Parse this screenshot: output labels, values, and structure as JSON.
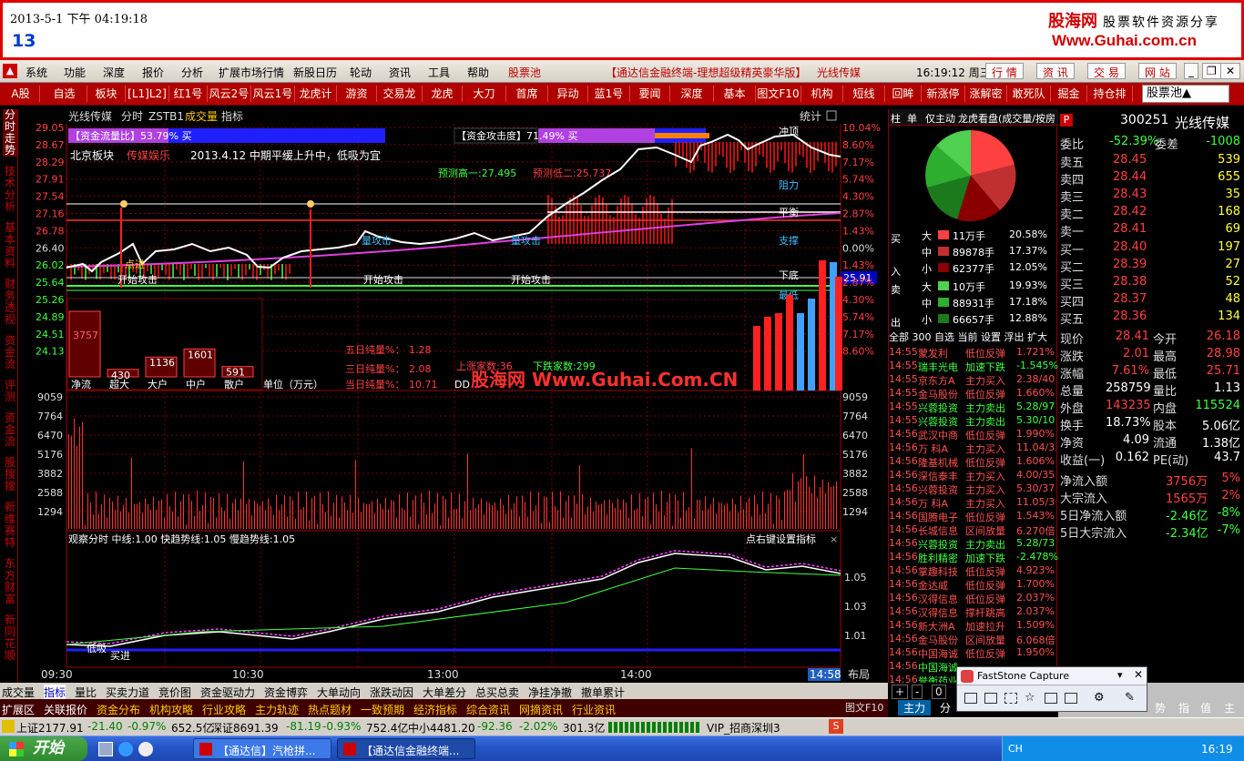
{
  "header": {
    "datetime": "2013-5-1 下午 04:19:18",
    "number": "13",
    "brand": "股海网",
    "brand_tag": "股票软件资源分享",
    "url": "Www.Guhai.com.cn"
  },
  "menu": {
    "items": [
      "系统",
      "功能",
      "深度",
      "报价",
      "分析",
      "扩展市场行情",
      "新股日历",
      "轮动",
      "资讯",
      "工具",
      "帮助"
    ],
    "stock_pool": "股票池",
    "title": "【通达信金融终端-理想超级精英豪华版】",
    "stock_title": "光线传媒",
    "time": "16:19:12 周三",
    "right_buttons": [
      "行 情",
      "资 讯",
      "交 易",
      "网 站"
    ]
  },
  "tabs": {
    "items": [
      "A股",
      "自选",
      "板块",
      "[L1]L2]",
      "红1号",
      "风云2号",
      "风云1号",
      "龙虎计",
      "游资",
      "交易龙",
      "龙虎",
      "大刀",
      "首席",
      "异动",
      "蓝1号",
      "要闻",
      "深度",
      "基本",
      "图文F10",
      "机构",
      "短线",
      "回眸",
      "新涨停",
      "涨解密",
      "敢死队",
      "掘金",
      "持仓排"
    ],
    "pool_select": "股票池▲"
  },
  "leftnav": [
    "分时走势",
    "技术分析",
    "基本资料",
    "财务透视",
    "资金流",
    "评测",
    "资金流",
    "股搜搜",
    "新维赛特",
    "东方财富",
    "新同花顺"
  ],
  "chart": {
    "title_items": [
      "光线传媒",
      "分时",
      "ZSTB1",
      "成交量",
      "指标"
    ],
    "stat_label": "统计",
    "zjl_label": "【资金流量比】53.79% 买",
    "zjgjd_label": "【资金攻击度】71.49% 买",
    "sector": "北京板块",
    "sector_tag": "传媒娱乐",
    "note": "2013.4.12 中期平缓上升中，低吸为宜",
    "pred_high": "预测高一:27.495",
    "pred_low": "预测低二:25.737",
    "zuli": "阻力",
    "pingheng": "平衡",
    "zhicheng": "支撑",
    "xiadi": "下底",
    "zuidi": "最低",
    "chongqi": "冲顶",
    "attack": "开始攻击",
    "attack2": "开始攻击",
    "qiang": "量攻击",
    "qiang2": "量攻击",
    "dian": "点进",
    "jin": "进",
    "chu": "出",
    "price_ticks": [
      "29.05",
      "28.67",
      "28.29",
      "27.91",
      "27.54",
      "27.16",
      "26.78",
      "26.40",
      "26.02",
      "25.64",
      "25.26",
      "24.89",
      "24.51",
      "24.13"
    ],
    "pct_ticks": [
      "10.04%",
      "8.60%",
      "7.17%",
      "5.74%",
      "4.30%",
      "2.87%",
      "1.43%",
      "0.00%",
      "1.43%",
      "2.87%",
      "4.30%",
      "5.74%",
      "7.17%",
      "8.60%"
    ],
    "current_price_tag": "25.91",
    "vol_ticks": [
      "9059",
      "7764",
      "6470",
      "5176",
      "3882",
      "2588",
      "1294"
    ],
    "money_flow": {
      "labels": [
        "净流",
        "超大",
        "大户",
        "中户",
        "散户"
      ],
      "values": [
        3757,
        430,
        1136,
        1601,
        591
      ],
      "unit": "单位（万元）"
    },
    "five_day": [
      {
        "label": "五日纯量%：",
        "value": "1.28"
      },
      {
        "label": "三日纯量%：",
        "value": "2.08"
      },
      {
        "label": "当日纯量%：",
        "value": "10.71"
      }
    ],
    "up_count": "上涨家数:36",
    "down_count": "下跌家数:299",
    "dd": "DD",
    "watermark": "股海网 Www.Guhai.Com.CN",
    "indicator": {
      "title": "观察分时 中线:1.00 快趋势线:1.05 慢趋势线:1.05",
      "setting": "点右键设置指标",
      "ticks": [
        "1.05",
        "1.03",
        "1.01"
      ],
      "ff": "低吸",
      "buy": "买进"
    },
    "time_axis": [
      "09:30",
      "10:30",
      "13:00",
      "14:00"
    ],
    "time_now": "14:58",
    "layout_label": "布局"
  },
  "chart_data": {
    "type": "line",
    "x": [
      "09:30",
      "10:30",
      "13:00",
      "14:00",
      "15:00"
    ],
    "series": [
      {
        "name": "光线传媒",
        "values": [
          26.4,
          26.1,
          26.6,
          28.0,
          28.41
        ]
      }
    ],
    "ylim": [
      24.13,
      29.05
    ]
  },
  "wpanel": {
    "tabs": [
      "柱",
      "单",
      "仅主动",
      "龙虎看盘(成交量/按房"
    ],
    "buy_rows": [
      {
        "k": "大",
        "v": "11万手",
        "p": "20.58%"
      },
      {
        "k": "中",
        "v": "89878手",
        "p": "17.37%"
      },
      {
        "k": "小",
        "v": "62377手",
        "p": "12.05%"
      }
    ],
    "sell_rows": [
      {
        "k": "大",
        "v": "10万手",
        "p": "19.93%"
      },
      {
        "k": "中",
        "v": "88931手",
        "p": "17.18%"
      },
      {
        "k": "小",
        "v": "66657手",
        "p": "12.88%"
      }
    ],
    "buy": "买",
    "in": "入",
    "sell": "卖",
    "out": "出",
    "filters": "全部 300  自选 当前 设置 浮出 扩大",
    "ticks": [
      [
        "14:55",
        "蒙发利",
        "低位反弹",
        "1.721%"
      ],
      [
        "14:55",
        "瑞丰光电",
        "加速下跌",
        "-1.545%"
      ],
      [
        "14:55",
        "京东方A",
        "主力买入",
        "2.38/40"
      ],
      [
        "14:55",
        "金马股份",
        "低位反弹",
        "1.660%"
      ],
      [
        "14:55",
        "兴蓉投资",
        "主力卖出",
        "5.28/97"
      ],
      [
        "14:55",
        "兴蓉投资",
        "主力卖出",
        "5.30/10"
      ],
      [
        "14:56",
        "武汉中商",
        "低位反弹",
        "1.990%"
      ],
      [
        "14:56",
        "万 科A",
        "主力买入",
        "11.04/3"
      ],
      [
        "14:56",
        "隆基机械",
        "低位反弹",
        "1.606%"
      ],
      [
        "14:56",
        "深信泰丰",
        "主力买入",
        "4.00/35"
      ],
      [
        "14:56",
        "兴蓉投资",
        "主力买入",
        "5.30/37"
      ],
      [
        "14:56",
        "万 科A",
        "主力买入",
        "11.05/3"
      ],
      [
        "14:56",
        "国腾电子",
        "低位反弹",
        "1.543%"
      ],
      [
        "14:56",
        "长城信息",
        "区间放量",
        "6.270倍"
      ],
      [
        "14:56",
        "兴蓉投资",
        "主力卖出",
        "5.28/73"
      ],
      [
        "14:56",
        "胜利精密",
        "加速下跌",
        "-2.478%"
      ],
      [
        "14:56",
        "掌趣科技",
        "低位反弹",
        "4.923%"
      ],
      [
        "14:56",
        "金达威",
        "低位反弹",
        "1.700%"
      ],
      [
        "14:56",
        "汉得信息",
        "低位反弹",
        "2.037%"
      ],
      [
        "14:56",
        "汉得信息",
        "撑杆跳高",
        "2.037%"
      ],
      [
        "14:56",
        "新大洲A",
        "加速拉升",
        "1.509%"
      ],
      [
        "14:56",
        "金马股份",
        "区间放量",
        "6.068倍"
      ],
      [
        "14:56",
        "中国海诚",
        "低位反弹",
        "1.950%"
      ],
      [
        "14:56",
        "中国海诚",
        "",
        ""
      ],
      [
        "14:56",
        "誉衡药业",
        "",
        ""
      ]
    ]
  },
  "quote": {
    "code": "300251",
    "name": "光线传媒",
    "weibi_l": "委比",
    "weibi": "-52.39%",
    "weicha_l": "委差",
    "weicha": "-1008",
    "asks": [
      {
        "l": "卖五",
        "p": "28.45",
        "v": "539"
      },
      {
        "l": "卖四",
        "p": "28.44",
        "v": "655"
      },
      {
        "l": "卖三",
        "p": "28.43",
        "v": "35"
      },
      {
        "l": "卖二",
        "p": "28.42",
        "v": "168"
      },
      {
        "l": "卖一",
        "p": "28.41",
        "v": "69"
      }
    ],
    "bids": [
      {
        "l": "买一",
        "p": "28.40",
        "v": "197"
      },
      {
        "l": "买二",
        "p": "28.39",
        "v": "27"
      },
      {
        "l": "买三",
        "p": "28.38",
        "v": "52"
      },
      {
        "l": "买四",
        "p": "28.37",
        "v": "48"
      },
      {
        "l": "买五",
        "p": "28.36",
        "v": "134"
      }
    ],
    "stats": [
      [
        "现价",
        "28.41",
        "今开",
        "26.18"
      ],
      [
        "涨跌",
        "2.01",
        "最高",
        "28.98"
      ],
      [
        "涨幅",
        "7.61%",
        "最低",
        "25.71"
      ],
      [
        "总量",
        "258759",
        "量比",
        "1.13"
      ],
      [
        "外盘",
        "143235",
        "内盘",
        "115524"
      ],
      [
        "换手",
        "18.73%",
        "股本",
        "5.06亿"
      ],
      [
        "净资",
        "4.09",
        "流通",
        "1.38亿"
      ],
      [
        "收益(一)",
        "0.162",
        "PE(动)",
        "43.7"
      ]
    ],
    "flows": [
      [
        "净流入额",
        "3756万",
        "5%"
      ],
      [
        "大宗流入",
        "1565万",
        "2%"
      ],
      [
        "5日净流入额",
        "-2.46亿",
        "-8%"
      ],
      [
        "5日大宗流入",
        "-2.34亿",
        "-7%"
      ]
    ]
  },
  "bottom_tabs1": [
    "成交量",
    "指标",
    "量比",
    "买卖力道",
    "竞价图",
    "资金驱动力",
    "资金博弈",
    "大单动向",
    "涨跌动因",
    "大单差分",
    "总买总卖",
    "净挂净撤",
    "撤单累计"
  ],
  "bottom_tabs2": [
    "扩展区",
    "关联报价",
    "资金分布",
    "机构攻略",
    "行业攻略",
    "主力轨迹",
    "热点题材",
    "一致预期",
    "经济指标",
    "综合资讯",
    "网摘资讯",
    "行业资讯"
  ],
  "bottom_right": [
    "图文F10",
    "主力",
    "分"
  ],
  "bottom_far": [
    "势",
    "指",
    "值",
    "主"
  ],
  "status": {
    "sh": "上证2177.91",
    "sh_chg": "-21.40",
    "sh_pct": "-0.97%",
    "sh_amt": "652.5亿",
    "sz": "深证8691.39",
    "sz_chg": "-81.19",
    "sz_pct": "-0.93%",
    "sz_amt": "752.4亿",
    "zx": "中小4481.20",
    "zx_chg": "-92.36",
    "zx_pct": "-2.02%",
    "zx_amt": "301.3亿",
    "vip": "VIP_招商深圳3"
  },
  "taskbar": {
    "start": "开始",
    "task1": "【通达信】汽枪拼...",
    "task2": "【通达信金融终端...",
    "lang": "CH",
    "clock": "16:19"
  },
  "fastcapture": {
    "title": "FastStone Capture"
  }
}
